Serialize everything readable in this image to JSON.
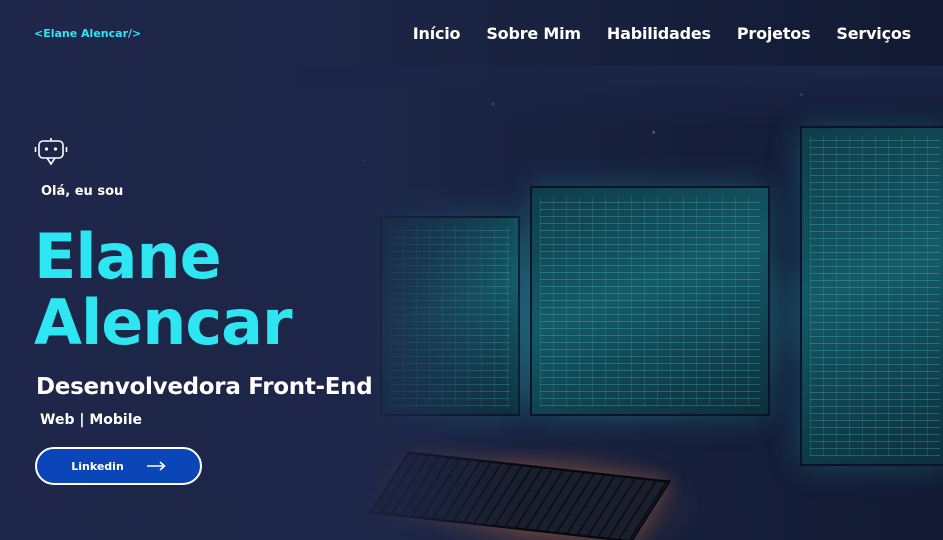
{
  "nav": {
    "logo": "<Elane Alencar/>",
    "items": [
      {
        "label": "Início"
      },
      {
        "label": "Sobre Mim"
      },
      {
        "label": "Habilidades"
      },
      {
        "label": "Projetos"
      },
      {
        "label": "Serviços"
      }
    ]
  },
  "hero": {
    "icon": "robot-icon",
    "greeting": "Olá, eu sou",
    "name_line1": "Elane",
    "name_line2": "Alencar",
    "role": "Desenvolvedora Front-End",
    "platforms": "Web | Mobile",
    "cta_label": "Linkedin",
    "cta_icon": "arrow-right-icon"
  },
  "colors": {
    "background": "#1c2547",
    "accent": "#2ee6f2",
    "button": "#0a46b8",
    "text": "#ffffff"
  }
}
